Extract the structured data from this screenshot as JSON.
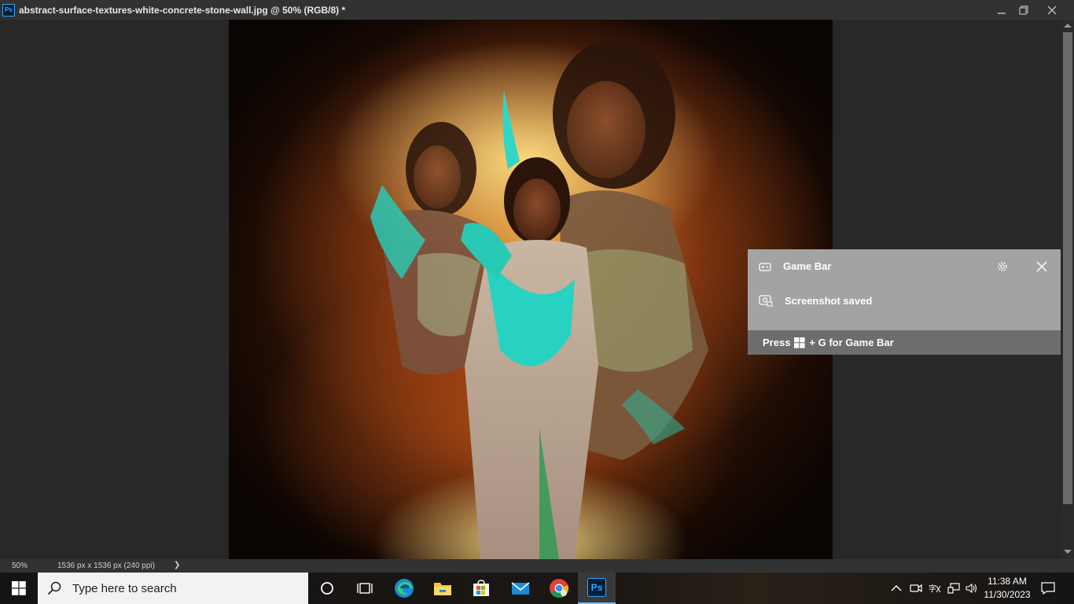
{
  "window": {
    "app_icon_text": "Ps",
    "title": "abstract-surface-textures-white-concrete-stone-wall.jpg @ 50% (RGB/8) *"
  },
  "canvas": {
    "description_icon": "composite-photo-image"
  },
  "status": {
    "zoom": "50%",
    "dimensions": "1536 px x 1536 px (240 ppi)",
    "arrow": "❯"
  },
  "game_bar": {
    "title": "Game Bar",
    "message": "Screenshot saved",
    "hint_prefix": "Press",
    "hint_suffix": "+ G for Game Bar"
  },
  "taskbar": {
    "search_placeholder": "Type here to search",
    "apps": [
      "cortana-icon",
      "task-view-icon",
      "edge-icon",
      "file-explorer-icon",
      "microsoft-store-icon",
      "mail-icon",
      "chrome-icon",
      "photoshop-icon"
    ],
    "photoshop_label": "Ps"
  },
  "clock": {
    "time": "11:38 AM",
    "date": "11/30/2023"
  },
  "colors": {
    "taskbar_active_underline": "#76b9ed",
    "photoshop_blue": "#31a8ff",
    "game_bar_bg": "#a3a3a3"
  }
}
